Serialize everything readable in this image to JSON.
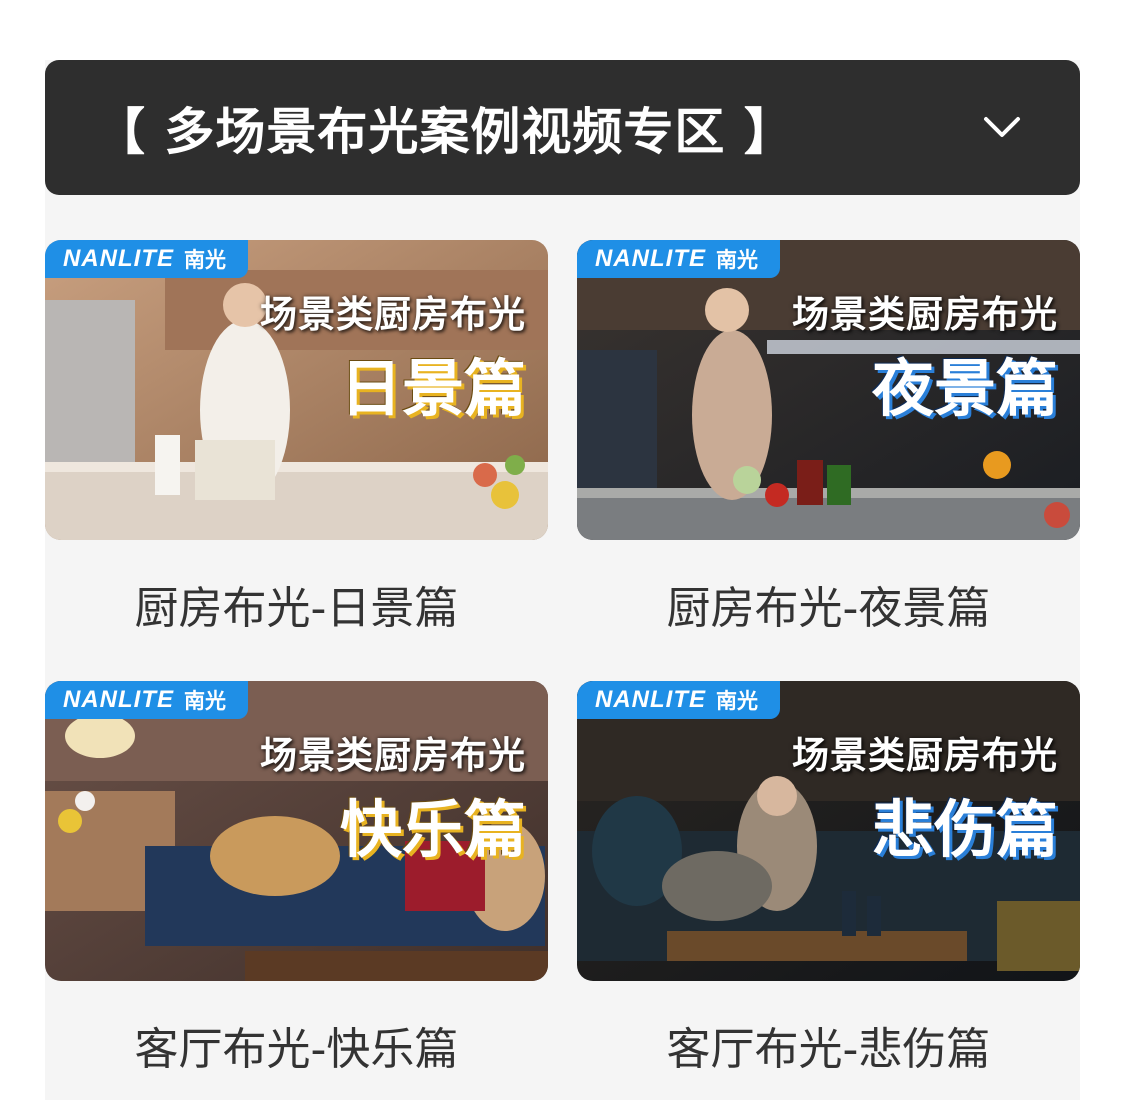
{
  "header": {
    "title": "【 多场景布光案例视频专区 】",
    "expand_icon": "chevron-down-icon"
  },
  "videos": [
    {
      "brand": "NANLITE",
      "brand_cn": "南光",
      "overlay_line1": "场景类厨房布光",
      "overlay_line2": "日景篇",
      "caption": "厨房布光-日景篇",
      "accent": "#e8b321"
    },
    {
      "brand": "NANLITE",
      "brand_cn": "南光",
      "overlay_line1": "场景类厨房布光",
      "overlay_line2": "夜景篇",
      "caption": "厨房布光-夜景篇",
      "accent": "#2a7fd8"
    },
    {
      "brand": "NANLITE",
      "brand_cn": "南光",
      "overlay_line1": "场景类厨房布光",
      "overlay_line2": "快乐篇",
      "caption": "客厅布光-快乐篇",
      "accent": "#e8b321"
    },
    {
      "brand": "NANLITE",
      "brand_cn": "南光",
      "overlay_line1": "场景类厨房布光",
      "overlay_line2": "悲伤篇",
      "caption": "客厅布光-悲伤篇",
      "accent": "#2a7fd8"
    }
  ],
  "colors": {
    "header_bg": "#2e2e2e",
    "panel_bg": "#f5f5f5",
    "badge_bg": "#1f8fe6"
  }
}
